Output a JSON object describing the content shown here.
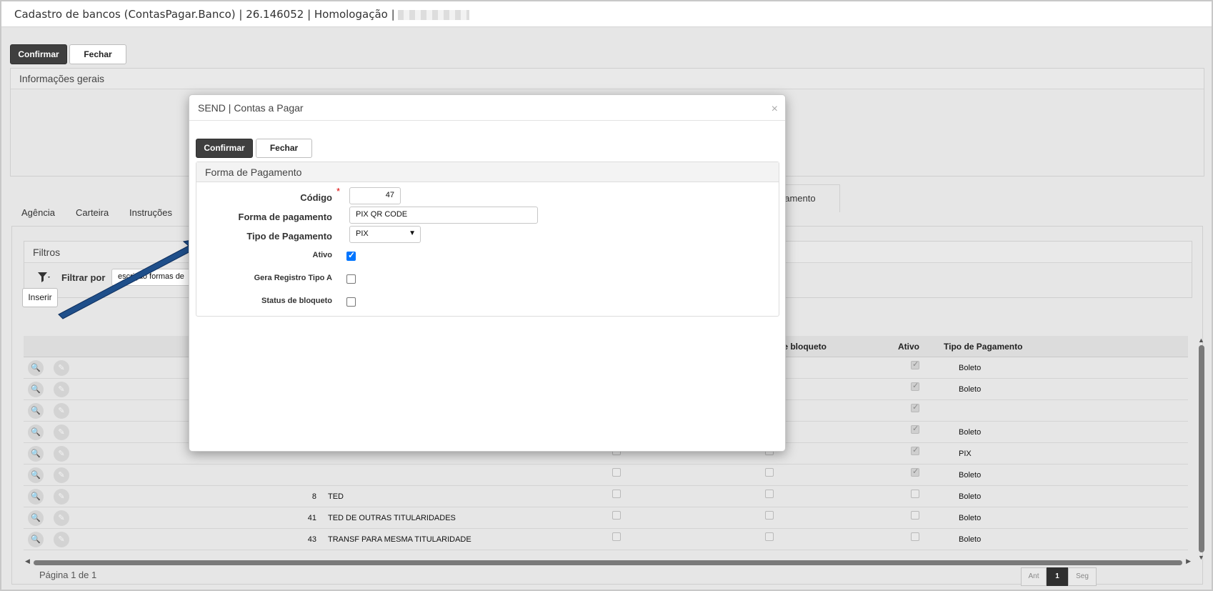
{
  "window": {
    "title": "Cadastro de bancos (ContasPagar.Banco) | 26.146052 | Homologação |"
  },
  "toolbar": {
    "confirm_label": "Confirmar",
    "close_label": "Fechar"
  },
  "general_info": {
    "title": "Informações gerais"
  },
  "tabs": [
    {
      "label": "Agência"
    },
    {
      "label": "Carteira"
    },
    {
      "label": "Instruções"
    },
    {
      "label": "gamento"
    }
  ],
  "filters": {
    "title": "Filtros",
    "filter_by_label": "Filtrar por",
    "field_value": "escrição formas de"
  },
  "insert_label": "Inserir",
  "grid": {
    "headers": {
      "blocket_status": "de bloqueto",
      "active": "Ativo",
      "payment_type": "Tipo de Pagamento"
    },
    "rows": [
      {
        "code": "",
        "name": "",
        "c1": false,
        "c2": false,
        "active": true,
        "type": "Boleto"
      },
      {
        "code": "",
        "name": "",
        "c1": false,
        "c2": false,
        "active": true,
        "type": "Boleto"
      },
      {
        "code": "",
        "name": "",
        "c1": false,
        "c2": false,
        "active": true,
        "type": ""
      },
      {
        "code": "",
        "name": "",
        "c1": false,
        "c2": false,
        "active": true,
        "type": "Boleto"
      },
      {
        "code": "",
        "name": "",
        "c1": false,
        "c2": false,
        "active": true,
        "type": "PIX"
      },
      {
        "code": "",
        "name": "",
        "c1": false,
        "c2": false,
        "active": true,
        "type": "Boleto"
      },
      {
        "code": "8",
        "name": "TED",
        "c1": false,
        "c2": false,
        "active": false,
        "type": "Boleto"
      },
      {
        "code": "41",
        "name": "TED DE OUTRAS TITULARIDADES",
        "c1": false,
        "c2": false,
        "active": false,
        "type": "Boleto"
      },
      {
        "code": "43",
        "name": "TRANSF PARA MESMA TITULARIDADE",
        "c1": false,
        "c2": false,
        "active": false,
        "type": "Boleto"
      }
    ]
  },
  "pager": {
    "text": "Página 1 de 1",
    "prev": "Ant",
    "current": "1",
    "next": "Seg"
  },
  "modal": {
    "title": "SEND | Contas a Pagar",
    "close_glyph": "×",
    "confirm_label": "Confirmar",
    "close_label": "Fechar",
    "section_title": "Forma de Pagamento",
    "required_mark": "*",
    "fields": {
      "codigo": {
        "label": "Código",
        "value": "47"
      },
      "forma": {
        "label": "Forma de pagamento",
        "value": "PIX QR CODE"
      },
      "tipo": {
        "label": "Tipo de Pagamento",
        "value": "PIX"
      },
      "ativo": {
        "label": "Ativo",
        "checked": true
      },
      "gera": {
        "label": "Gera Registro Tipo A",
        "checked": false
      },
      "status": {
        "label": "Status de bloqueto",
        "checked": false
      }
    }
  },
  "colors": {
    "dark_button": "#3f3f3f",
    "arrow": "#1f4f8a",
    "checkbox_on": "#0075ff"
  }
}
